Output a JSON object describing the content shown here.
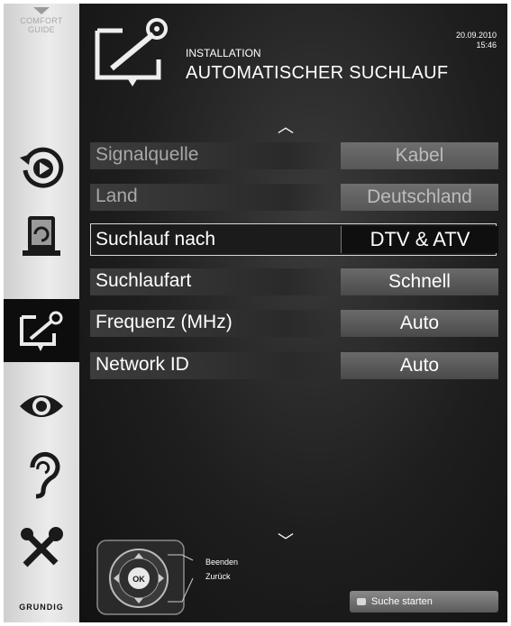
{
  "sidebar": {
    "comfort_guide": "COMFORT\nGUIDE",
    "items": [
      {
        "name": "source",
        "icon": "rotate-play-icon"
      },
      {
        "name": "media",
        "icon": "tablet-sync-icon"
      },
      {
        "name": "installation",
        "icon": "antenna-screen-icon",
        "active": true
      },
      {
        "name": "picture",
        "icon": "eye-icon"
      },
      {
        "name": "sound",
        "icon": "ear-icon"
      },
      {
        "name": "settings",
        "icon": "tools-icon"
      }
    ],
    "brand": "GRUNDIG"
  },
  "header": {
    "subtitle": "INSTALLATION",
    "title": "AUTOMATISCHER SUCHLAUF",
    "date": "20.09.2010",
    "time": "15:46"
  },
  "menu": {
    "rows": [
      {
        "label": "Signalquelle",
        "value": "Kabel",
        "state": "dim"
      },
      {
        "label": "Land",
        "value": "Deutschland",
        "state": "dim"
      },
      {
        "label": "Suchlauf nach",
        "value": "DTV & ATV",
        "state": "selected"
      },
      {
        "label": "Suchlaufart",
        "value": "Schnell",
        "state": "normal"
      },
      {
        "label": "Frequenz (MHz)",
        "value": "Auto",
        "state": "normal"
      },
      {
        "label": "Network ID",
        "value": "Auto",
        "state": "normal"
      }
    ]
  },
  "footer": {
    "remote_ok": "OK",
    "legend_exit": "Beenden",
    "legend_back": "Zurück",
    "start_button": "Suche starten"
  },
  "colors": {
    "background": "#111111",
    "sidebar": "#dcdcdc",
    "value_field": "#5a5a5a",
    "selected_border": "#d8d8d8"
  }
}
